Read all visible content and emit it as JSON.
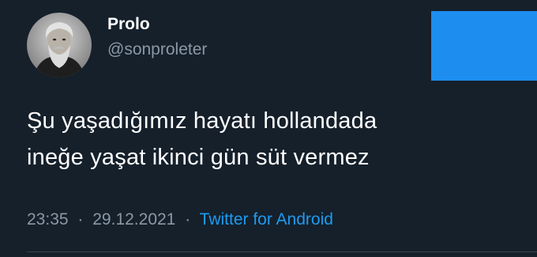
{
  "user": {
    "display_name": "Prolo",
    "handle": "@sonproleter"
  },
  "tweet": {
    "lines": [
      "Şu yaşadığımız hayatı hollandada",
      "ineğe yaşat ikinci gün süt vermez"
    ],
    "time": "23:35",
    "separator": "·",
    "date": "29.12.2021",
    "source": "Twitter for Android"
  },
  "colors": {
    "background": "#15202b",
    "text": "#ffffff",
    "muted": "#8b98a5",
    "accent": "#1d9bf0",
    "follow_block": "#1d8ef0"
  },
  "icons": {
    "avatar": "avatar-portrait"
  }
}
